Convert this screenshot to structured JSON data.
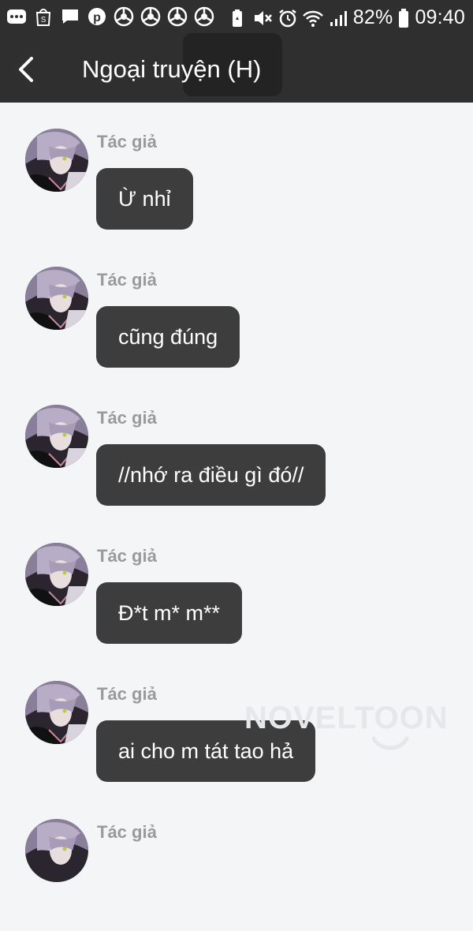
{
  "status_bar": {
    "battery_percent": "82%",
    "time": "09:40",
    "left_icons": [
      "more-dots-icon",
      "shopping-bag-icon",
      "message-icon",
      "pinterest-icon",
      "chrome-icon",
      "chrome-icon",
      "chrome-icon",
      "chrome-icon"
    ],
    "right_icons": [
      "battery-saver-icon",
      "mute-icon",
      "alarm-icon",
      "wifi-icon",
      "signal-icon",
      "battery-icon"
    ]
  },
  "header": {
    "title": "Ngoại truyện (H)",
    "back_icon": "chevron-left-icon"
  },
  "chat": {
    "messages": [
      {
        "author": "Tác giả",
        "text": "Ừ nhỉ"
      },
      {
        "author": "Tác giả",
        "text": "cũng đúng"
      },
      {
        "author": "Tác giả",
        "text": "//nhớ ra điều gì đó//"
      },
      {
        "author": "Tác giả",
        "text": "Đ*t m* m**"
      },
      {
        "author": "Tác giả",
        "text": "ai cho m tát tao hả"
      },
      {
        "author": "Tác giả",
        "text": ""
      }
    ]
  },
  "watermark": {
    "text": "NOVELTOON"
  },
  "colors": {
    "header_bg": "#2f2f2f",
    "page_bg": "#f4f5f7",
    "bubble_bg": "#3d3d3d",
    "author_text": "#9a9a9a"
  }
}
